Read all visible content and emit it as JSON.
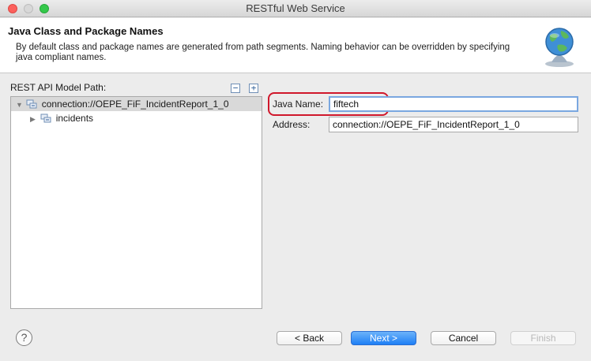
{
  "window": {
    "title": "RESTful Web Service"
  },
  "banner": {
    "title": "Java Class and Package Names",
    "description": "By default class and package names are generated from path segments.  Naming behavior can be overridden by specifying java compliant names."
  },
  "tree_panel": {
    "label": "REST API Model Path:",
    "collapse_all": "−",
    "expand_all": "+",
    "items": [
      {
        "label": "connection://OEPE_FiF_IncidentReport_1_0",
        "expanded": true,
        "selected": true
      },
      {
        "label": "incidents",
        "expanded": false,
        "selected": false
      }
    ]
  },
  "form": {
    "java_name_label": "Java Name:",
    "java_name_value": "fiftech",
    "address_label": "Address:",
    "address_value": "connection://OEPE_FiF_IncidentReport_1_0"
  },
  "buttons": {
    "help": "?",
    "back": "< Back",
    "next": "Next >",
    "cancel": "Cancel",
    "finish": "Finish"
  },
  "colors": {
    "accent": "#1e7ff5",
    "highlight_annotation": "#d0172b",
    "selection": "#d9d9d9"
  }
}
